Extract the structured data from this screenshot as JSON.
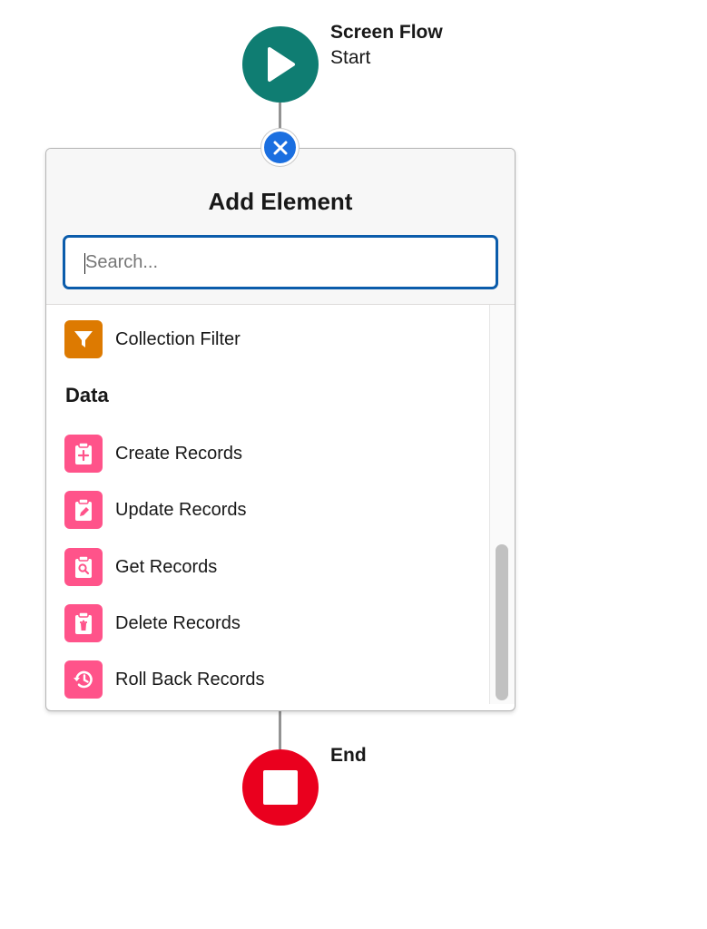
{
  "start_node": {
    "title": "Screen Flow",
    "subtitle": "Start",
    "color": "#0f7d72"
  },
  "add_element_panel": {
    "title": "Add Element",
    "search": {
      "placeholder": "Search...",
      "value": ""
    },
    "items": [
      {
        "label": "Collection Filter",
        "icon": "filter-icon",
        "color": "#dd7a01"
      }
    ],
    "sections": [
      {
        "heading": "Data",
        "items": [
          {
            "label": "Create Records",
            "icon": "clipboard-add-icon",
            "color": "#ff538a"
          },
          {
            "label": "Update Records",
            "icon": "clipboard-edit-icon",
            "color": "#ff538a"
          },
          {
            "label": "Get Records",
            "icon": "clipboard-search-icon",
            "color": "#ff538a"
          },
          {
            "label": "Delete Records",
            "icon": "clipboard-delete-icon",
            "color": "#ff538a"
          },
          {
            "label": "Roll Back Records",
            "icon": "rollback-icon",
            "color": "#ff538a"
          }
        ]
      }
    ]
  },
  "end_node": {
    "title": "End",
    "color": "#ea001e"
  },
  "colors": {
    "close_button": "#1b6fe0",
    "search_border": "#0b5cab"
  }
}
